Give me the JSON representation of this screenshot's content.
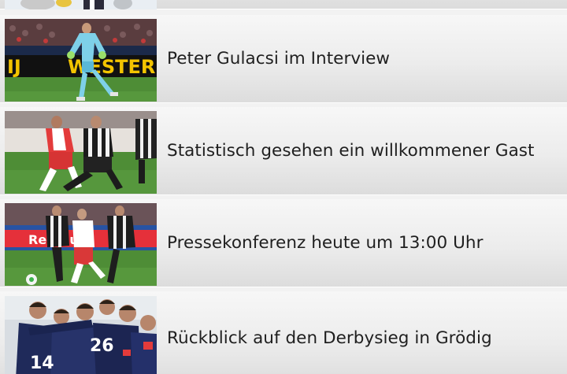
{
  "news": {
    "items": [
      {
        "title": "",
        "thumbnail": "football-photo-thumb"
      },
      {
        "title": "Peter Gulacsi im Interview",
        "thumbnail": "goalkeeper-photo-thumb"
      },
      {
        "title": "Statistisch gesehen ein willkommener Gast",
        "thumbnail": "match-duel-photo-thumb"
      },
      {
        "title": "Pressekonferenz heute um 13:00 Uhr",
        "thumbnail": "match-action-photo-thumb"
      },
      {
        "title": "Rückblick auf den Derbysieg in Grödig",
        "thumbnail": "team-celebration-photo-thumb"
      }
    ]
  },
  "colors": {
    "row_background": "#ececec",
    "title_text": "#1f1f1f",
    "pitch_green": "#4e8d36"
  }
}
